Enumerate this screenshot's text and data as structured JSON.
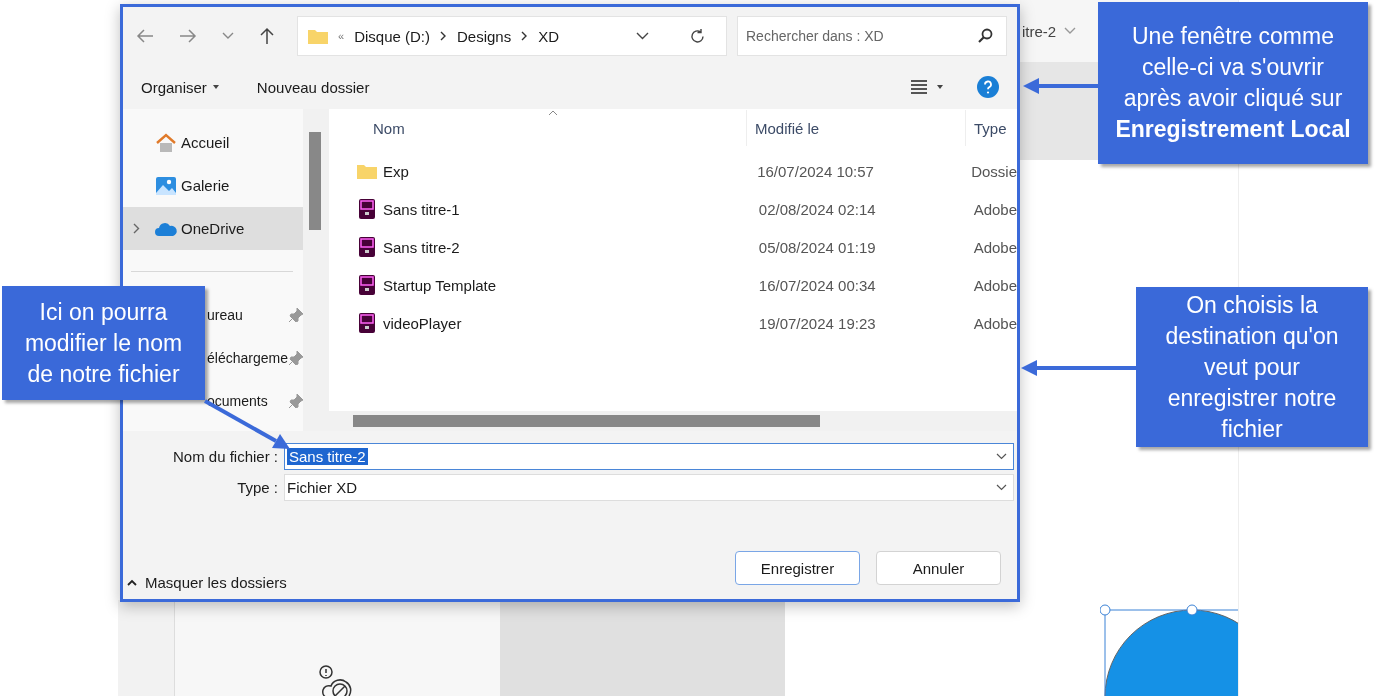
{
  "background_app": {
    "tab": "itre-2"
  },
  "dialog": {
    "address": {
      "overflow": "«",
      "crumbs": [
        "Disque (D:)",
        "Designs",
        "XD"
      ]
    },
    "search": {
      "placeholder": "Rechercher dans : XD"
    },
    "toolbar": {
      "organize": "Organiser",
      "new_folder": "Nouveau dossier"
    },
    "nav_items": [
      {
        "kind": "home",
        "label": "Accueil",
        "selected": false,
        "expandable": false,
        "pinned": false
      },
      {
        "kind": "gallery",
        "label": "Galerie",
        "selected": false,
        "expandable": false,
        "pinned": false
      },
      {
        "kind": "cloud",
        "label": "OneDrive",
        "selected": true,
        "expandable": true,
        "pinned": false
      },
      {
        "kind": "quick_access",
        "label": "ureau",
        "selected": false,
        "expandable": false,
        "pinned": true
      },
      {
        "kind": "quick_access",
        "label": "éléchargeme",
        "selected": false,
        "expandable": false,
        "pinned": true
      },
      {
        "kind": "quick_access",
        "label": "ocuments",
        "selected": false,
        "expandable": false,
        "pinned": true
      }
    ],
    "columns": [
      "Nom",
      "Modifié le",
      "Type"
    ],
    "files": [
      {
        "kind": "folder",
        "name": "Exp",
        "modified": "16/07/2024 10:57",
        "type": "Dossie"
      },
      {
        "kind": "xd",
        "name": "Sans titre-1",
        "modified": "02/08/2024 02:14",
        "type": "Adobe"
      },
      {
        "kind": "xd",
        "name": "Sans titre-2",
        "modified": "05/08/2024 01:19",
        "type": "Adobe"
      },
      {
        "kind": "xd",
        "name": "Startup Template",
        "modified": "16/07/2024 00:34",
        "type": "Adobe"
      },
      {
        "kind": "xd",
        "name": "videoPlayer",
        "modified": "19/07/2024 19:23",
        "type": "Adobe"
      }
    ],
    "filename": {
      "label": "Nom du fichier :",
      "value": "Sans titre-2"
    },
    "filetype": {
      "label": "Type :",
      "value": "Fichier XD"
    },
    "toggle_folders": "Masquer les dossiers",
    "buttons": [
      {
        "label": "Enregistrer",
        "primary": true
      },
      {
        "label": "Annuler",
        "primary": false
      }
    ]
  },
  "callouts": [
    {
      "text": "Une fenêtre comme celle-ci va s'ouvrir après avoir cliqué sur **Enregistrement Local**"
    },
    {
      "text": "Ici on pourra modifier le nom de notre fichier"
    },
    {
      "text": "On choisis la destination qu'on veut pour enregistrer notre fichier"
    }
  ]
}
